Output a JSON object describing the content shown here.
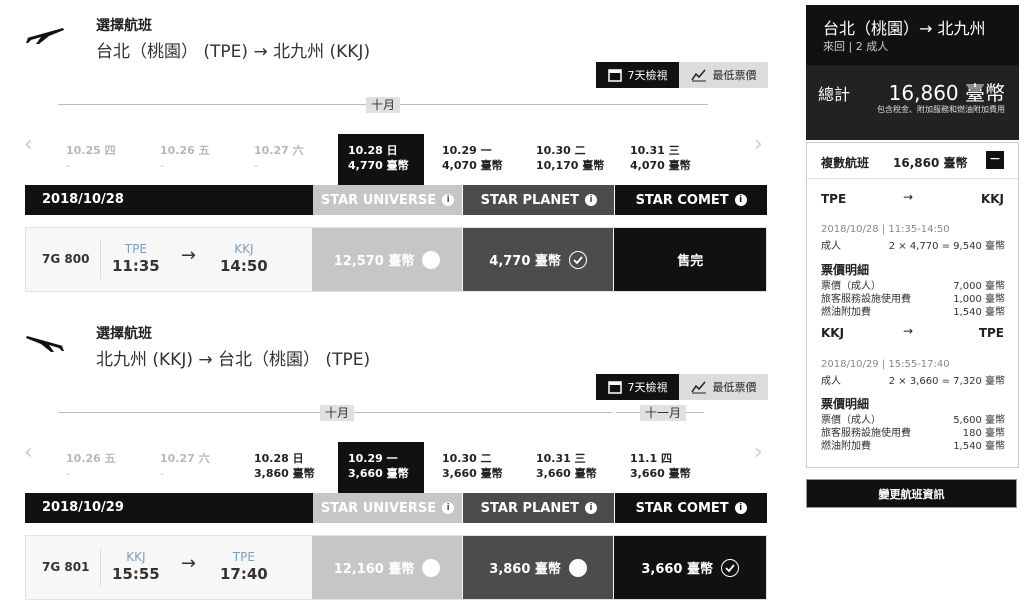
{
  "outbound": {
    "select_title": "選擇航班",
    "route": "台北（桃園） (TPE) → 北九州 (KKJ)",
    "view_7day": "7天檢視",
    "view_lowest": "最低票價",
    "months": [
      "十月"
    ],
    "dates": [
      {
        "date": "10.25 四",
        "price": "-",
        "state": "disabled"
      },
      {
        "date": "10.26 五",
        "price": "-",
        "state": "disabled"
      },
      {
        "date": "10.27 六",
        "price": "-",
        "state": "disabled"
      },
      {
        "date": "10.28 日",
        "price": "4,770 臺幣",
        "state": "selected"
      },
      {
        "date": "10.29 一",
        "price": "4,070 臺幣",
        "state": "normal"
      },
      {
        "date": "10.30 二",
        "price": "10,170 臺幣",
        "state": "normal"
      },
      {
        "date": "10.31 三",
        "price": "4,070 臺幣",
        "state": "normal"
      }
    ],
    "header_date": "2018/10/28",
    "fare_classes": [
      "STAR UNIVERSE",
      "STAR PLANET",
      "STAR COMET"
    ],
    "flight": {
      "number": "7G 800",
      "from_code": "TPE",
      "from_time": "11:35",
      "to_code": "KKJ",
      "to_time": "14:50",
      "universe": "12,570 臺幣",
      "planet": "4,770 臺幣",
      "comet": "售完"
    }
  },
  "inbound": {
    "select_title": "選擇航班",
    "route": "北九州 (KKJ) → 台北（桃園） (TPE)",
    "view_7day": "7天檢視",
    "view_lowest": "最低票價",
    "months": [
      "十月",
      "十一月"
    ],
    "dates": [
      {
        "date": "10.26 五",
        "price": "-",
        "state": "disabled"
      },
      {
        "date": "10.27 六",
        "price": "-",
        "state": "disabled"
      },
      {
        "date": "10.28 日",
        "price": "3,860 臺幣",
        "state": "normal"
      },
      {
        "date": "10.29 一",
        "price": "3,660 臺幣",
        "state": "selected"
      },
      {
        "date": "10.30 二",
        "price": "3,660 臺幣",
        "state": "normal"
      },
      {
        "date": "10.31 三",
        "price": "3,660 臺幣",
        "state": "normal"
      },
      {
        "date": "11.1 四",
        "price": "3,660 臺幣",
        "state": "normal"
      }
    ],
    "header_date": "2018/10/29",
    "fare_classes": [
      "STAR UNIVERSE",
      "STAR PLANET",
      "STAR COMET"
    ],
    "flight": {
      "number": "7G 801",
      "from_code": "KKJ",
      "from_time": "15:55",
      "to_code": "TPE",
      "to_time": "17:40",
      "universe": "12,160 臺幣",
      "planet": "3,860 臺幣",
      "comet": "3,660 臺幣"
    }
  },
  "summary": {
    "route": "台北（桃園）→ 北九州",
    "sub": "來回 | 2 成人",
    "total_label": "總計",
    "total_amount": "16,860 臺幣",
    "total_note": "包含稅金、附加服務和燃油附加費用",
    "multi_label": "複數航班",
    "multi_amount": "16,860 臺幣",
    "legs": [
      {
        "from": "TPE",
        "to": "KKJ",
        "arrow": "→",
        "datetime": "2018/10/28 | 11:35-14:50",
        "adult_label": "成人",
        "adult_calc": "2 × 4,770 = 9,540 臺幣",
        "breakdown_title": "票價明細",
        "lines": [
          {
            "label": "票價（成人）",
            "value": "7,000 臺幣"
          },
          {
            "label": "旅客服務設施使用費",
            "value": "1,000 臺幣"
          },
          {
            "label": "燃油附加費",
            "value": "1,540 臺幣"
          }
        ]
      },
      {
        "from": "KKJ",
        "to": "TPE",
        "arrow": "→",
        "datetime": "2018/10/29 | 15:55-17:40",
        "adult_label": "成人",
        "adult_calc": "2 × 3,660 = 7,320 臺幣",
        "breakdown_title": "票價明細",
        "lines": [
          {
            "label": "票價（成人）",
            "value": "5,600 臺幣"
          },
          {
            "label": "旅客服務設施使用費",
            "value": "180 臺幣"
          },
          {
            "label": "燃油附加費",
            "value": "1,540 臺幣"
          }
        ]
      }
    ],
    "change_button": "變更航班資訊"
  }
}
